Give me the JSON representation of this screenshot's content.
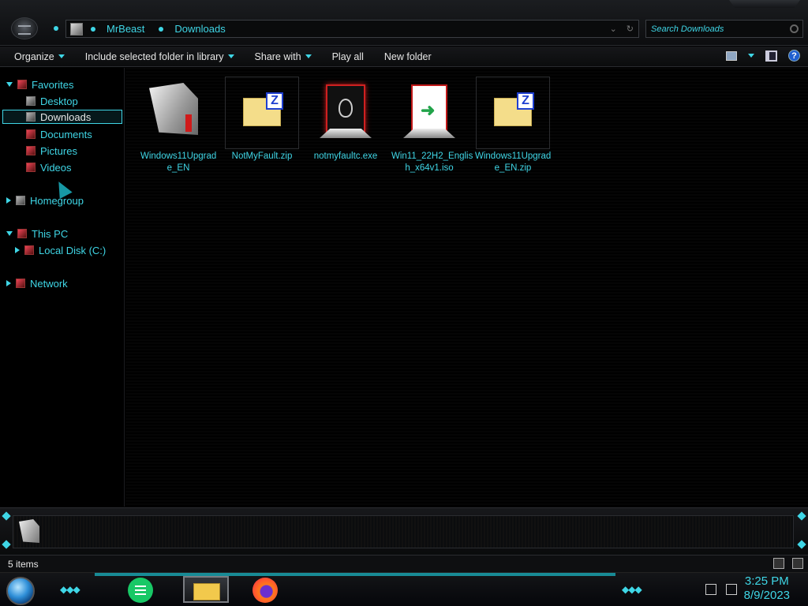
{
  "address": {
    "crumbs": [
      "MrBeast",
      "Downloads"
    ]
  },
  "search": {
    "placeholder": "Search Downloads"
  },
  "toolbar": {
    "organize": "Organize",
    "include_library": "Include selected folder in library",
    "share_with": "Share with",
    "play_all": "Play all",
    "new_folder": "New folder",
    "help": "?"
  },
  "nav": {
    "favorites": "Favorites",
    "desktop": "Desktop",
    "downloads": "Downloads",
    "documents": "Documents",
    "pictures": "Pictures",
    "videos": "Videos",
    "homegroup": "Homegroup",
    "this_pc": "This PC",
    "local_disk": "Local Disk (C:)",
    "network": "Network"
  },
  "files": [
    {
      "name": "Windows11Upgrade_EN",
      "line1": "Windows11Upgrad",
      "line2": "e_EN",
      "icon": "setup-icon"
    },
    {
      "name": "NotMyFault.zip",
      "line1": "NotMyFault.zip",
      "line2": "",
      "icon": "zip-icon"
    },
    {
      "name": "notmyfaultc.exe",
      "line1": "notmyfaultc.exe",
      "line2": "",
      "icon": "alien-exe-icon"
    },
    {
      "name": "Win11_22H2_English_x64v1.iso",
      "line1": "Win11_22H2_Englis",
      "line2": "h_x64v1.iso",
      "icon": "iso-icon"
    },
    {
      "name": "Windows11Upgrade_EN.zip",
      "line1": "Windows11Upgrad",
      "line2": "e_EN.zip",
      "icon": "zip-icon"
    }
  ],
  "status": {
    "items": "5 items"
  },
  "clock": {
    "time": "3:25 PM",
    "date": "8/9/2023"
  },
  "colors": {
    "accent": "#3fd6e6",
    "background": "#000000"
  }
}
